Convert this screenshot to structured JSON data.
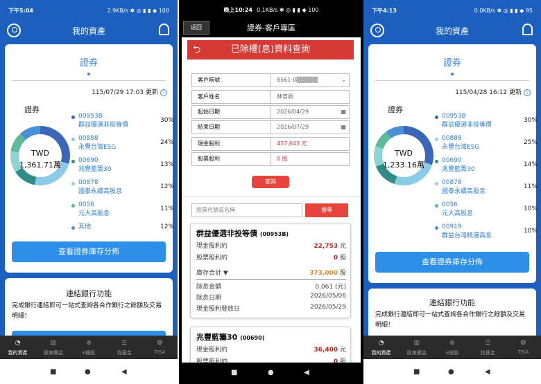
{
  "phone1": {
    "status": {
      "time": "下午5:04",
      "right": "2.9KB/s ✱ ◎ ▮ ▮ ◆ 100"
    },
    "header": {
      "title": "我的資產"
    },
    "tab_title": "證券",
    "updated": "115/07/29 17:03 更新",
    "section_label": "證券",
    "currency": "TWD",
    "total": "1,361.71萬",
    "legend": [
      {
        "name": "00953B\n群益優選非投等債",
        "pct": "30%",
        "color": "#3b67b8"
      },
      {
        "name": "00888\n永豐台灣ESG",
        "pct": "24%",
        "color": "#8ccbe8"
      },
      {
        "name": "00690\n兆豐藍籌30",
        "pct": "13%",
        "color": "#2f8d85"
      },
      {
        "name": "00878\n國泰永續高股息",
        "pct": "12%",
        "color": "#8ed5d2"
      },
      {
        "name": "0056\n元大高股息",
        "pct": "11%",
        "color": "#5dbb9c"
      },
      {
        "name": "其他",
        "pct": "12%",
        "color": "#4a90d9"
      }
    ],
    "button": "查看證券庫存分佈",
    "bank_title": "連結銀行功能",
    "bank_text": "完成銀行連結即可一站式查詢各合作銀行之餘額及交易明細！"
  },
  "phone2": {
    "status": {
      "time": "晚上10:24",
      "right": "0.1KB/s ✱ ◎ ▮ ▮ ◆ 100"
    },
    "back": "返回",
    "header": "證券-客戶專區",
    "page_title": "已除權(息)資料查詢",
    "fields": [
      {
        "k": "客戶帳號",
        "v": "8561-0▒▒▒▒▒"
      },
      {
        "k": "客戶姓名",
        "v": "林育辰"
      },
      {
        "k": "起始日期",
        "v": "2026/04/29"
      },
      {
        "k": "結束日期",
        "v": "2026/07/29"
      },
      {
        "k": "現金股利",
        "v": "437,643 元"
      },
      {
        "k": "股票股利",
        "v": "0 股"
      }
    ],
    "query": "查詢",
    "search_placeholder": "股票代號或名稱",
    "search_btn": "搜尋",
    "card1": {
      "name": "群益優選非投等債",
      "code": "(00953B)",
      "l1": "現金股利約",
      "v1": "22,753",
      "u1": "元",
      "l2": "股票股利約",
      "v2": "0",
      "u2": "股",
      "l3": "庫存合計",
      "v3": "373,000",
      "u3": "股",
      "l4": "除息金額",
      "v4": "0.061 (元)",
      "l5": "除息日期",
      "v5": "2026/05/06",
      "l6": "現金股利發放日",
      "v6": "2026/05/29"
    },
    "card2": {
      "name": "兆豐藍籌30",
      "code": "(00690)",
      "l1": "現金股利約",
      "v1": "36,400",
      "u1": "元",
      "l2": "股票股利約",
      "v2": "0",
      "u2": "股"
    }
  },
  "phone3": {
    "status": {
      "time": "下午4:13",
      "right": "0.0KB/s ✱ ◎ ▮ ▮ ◆ 95"
    },
    "header": {
      "title": "我的資產"
    },
    "tab_title": "證券",
    "updated": "115/04/28 16:12 更新",
    "section_label": "證券",
    "currency": "TWD",
    "total": "1,233.16萬",
    "legend": [
      {
        "name": "00953B\n群益優選非投等債",
        "pct": "30%",
        "color": "#3b67b8"
      },
      {
        "name": "00888\n永豐台灣ESG",
        "pct": "25%",
        "color": "#8ccbe8"
      },
      {
        "name": "00690\n兆豐藍籌30",
        "pct": "14%",
        "color": "#2f8d85"
      },
      {
        "name": "00878\n國泰永續高股息",
        "pct": "11%",
        "color": "#8ed5d2"
      },
      {
        "name": "0056\n元大高股息",
        "pct": "10%",
        "color": "#5dbb9c"
      },
      {
        "name": "00919\n群益台灣精選高息",
        "pct": "10%",
        "color": "#4a90d9"
      }
    ],
    "button": "查看證券庫存分佈",
    "bank_title": "連結銀行功能",
    "bank_text": "完成銀行連結即可一站式查詢各合作銀行之餘額及交易明細！"
  },
  "tabbar": [
    {
      "label": "我的資產",
      "icon": "pie-icon"
    },
    {
      "label": "股東權益",
      "icon": "book-icon"
    },
    {
      "label": "e搜股",
      "icon": "search-icon"
    },
    {
      "label": "找基金",
      "icon": "list-icon"
    },
    {
      "label": "TISA",
      "icon": "coins-icon"
    }
  ],
  "navbar": {
    "square": "■",
    "circle": "●",
    "back": "◀"
  }
}
